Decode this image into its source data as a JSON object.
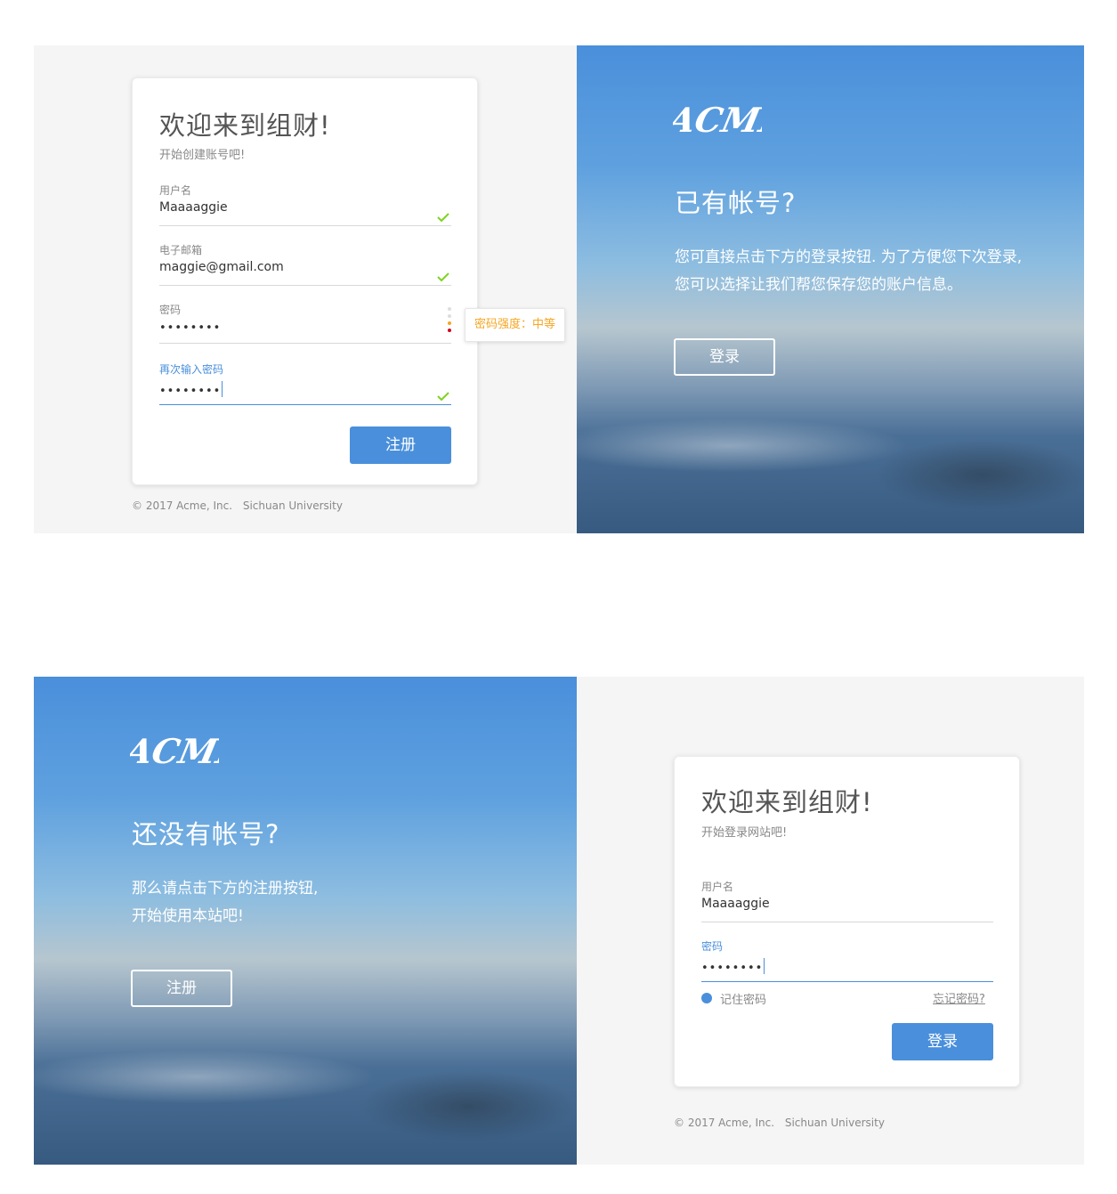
{
  "register": {
    "title": "欢迎来到组财!",
    "subtitle": "开始创建账号吧!",
    "username_label": "用户名",
    "username_value": "Maaaaggie",
    "email_label": "电子邮箱",
    "email_value": "maggie@gmail.com",
    "password_label": "密码",
    "password_value": "••••••••",
    "confirm_label": "再次输入密码",
    "confirm_value": "••••••••",
    "submit_label": "注册",
    "strength_tooltip": "密码强度：中等",
    "strength_level": "中等",
    "footer_copyright": "© 2017 Acme, Inc.",
    "footer_org": "Sichuan University"
  },
  "has_account": {
    "logo": "ACME",
    "heading": "已有帐号?",
    "text_line1": "您可直接点击下方的登录按钮. 为了方便您下次登录,",
    "text_line2": "您可以选择让我们帮您保存您的账户信息。",
    "button_label": "登录"
  },
  "no_account": {
    "logo": "ACME",
    "heading": "还没有帐号?",
    "text_line1": "那么请点击下方的注册按钮,",
    "text_line2": "开始使用本站吧!",
    "button_label": "注册"
  },
  "login": {
    "title": "欢迎来到组财!",
    "subtitle": "开始登录网站吧!",
    "username_label": "用户名",
    "username_value": "Maaaaggie",
    "password_label": "密码",
    "password_value": "••••••••",
    "remember_label": "记住密码",
    "forgot_label": "忘记密码?",
    "submit_label": "登录",
    "footer_copyright": "© 2017 Acme, Inc.",
    "footer_org": "Sichuan University"
  },
  "colors": {
    "accent": "#4a8fdb",
    "valid": "#7ed321",
    "warning": "#f5a623",
    "error": "#d0021b"
  }
}
